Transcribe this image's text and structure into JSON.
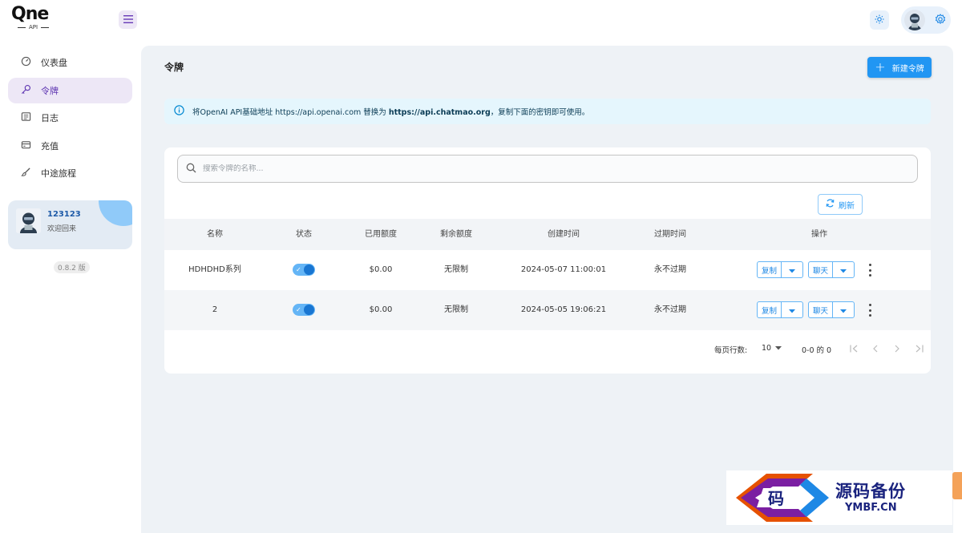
{
  "brand": {
    "name": "Qne",
    "sub": "API"
  },
  "sidebar": {
    "items": [
      {
        "label": "仪表盘",
        "icon": "dashboard-icon"
      },
      {
        "label": "令牌",
        "icon": "key-icon"
      },
      {
        "label": "日志",
        "icon": "log-icon"
      },
      {
        "label": "充值",
        "icon": "wallet-icon"
      },
      {
        "label": "中途旅程",
        "icon": "brush-icon"
      }
    ],
    "active_index": 1,
    "user": {
      "name": "123123",
      "welcome": "欢迎回来"
    },
    "version": "0.8.2 版"
  },
  "page": {
    "title": "令牌",
    "new_button": "新建令牌",
    "alert": {
      "prefix": "将OpenAI API基础地址 https://api.openai.com 替换为 ",
      "highlight": "https://api.chatmao.org",
      "suffix": "，复制下面的密钥即可使用。"
    },
    "search": {
      "placeholder": "搜索令牌的名称...",
      "value": ""
    },
    "refresh_button": "刷新",
    "table": {
      "columns": [
        "名称",
        "状态",
        "已用额度",
        "剩余额度",
        "创建时间",
        "过期时间",
        "操作"
      ],
      "rows": [
        {
          "name": "HDHDHD系列",
          "enabled": true,
          "used": "$0.00",
          "remaining": "无限制",
          "created": "2024-05-07 11:00:01",
          "expires": "永不过期",
          "copy": "复制",
          "chat": "聊天"
        },
        {
          "name": "2",
          "enabled": true,
          "used": "$0.00",
          "remaining": "无限制",
          "created": "2024-05-05 19:06:21",
          "expires": "永不过期",
          "copy": "复制",
          "chat": "聊天"
        }
      ]
    },
    "pagination": {
      "rows_per_page_label": "每页行数:",
      "rows_per_page": "10",
      "range": "0-0 的 0"
    }
  },
  "watermark": {
    "glyph": "码",
    "title": "源码备份",
    "url": "YMBF.CN"
  },
  "colors": {
    "accent": "#2196f3",
    "active_nav": "#5e35b1",
    "alert_bg": "#e5f6fd"
  }
}
